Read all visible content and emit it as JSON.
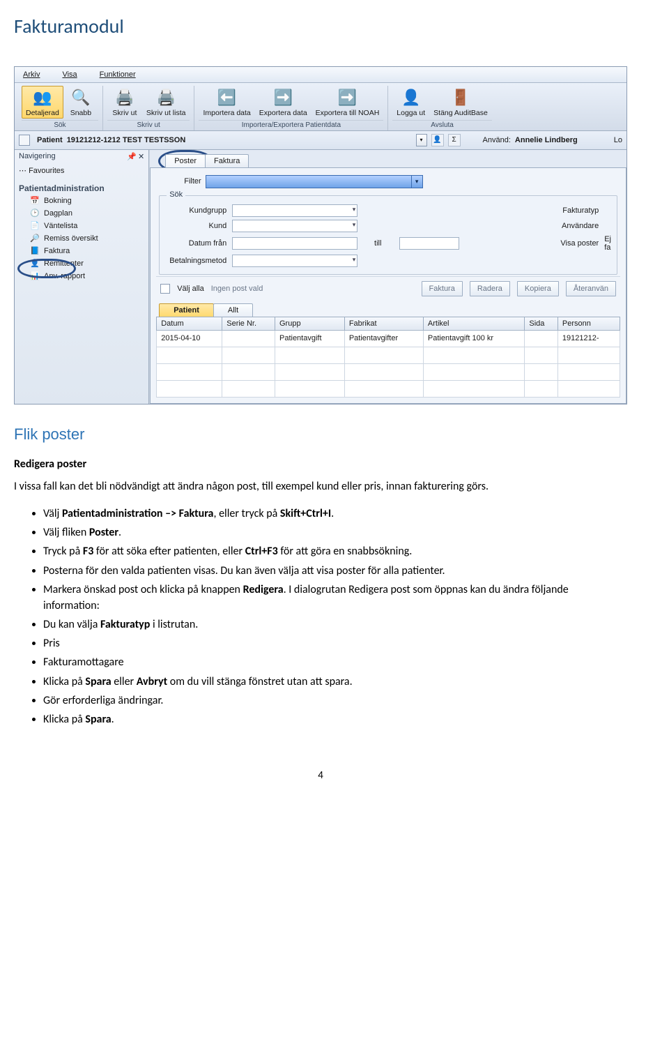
{
  "doc": {
    "page_title": "Fakturamodul",
    "section_title": "Flik poster",
    "sub_heading": "Redigera poster",
    "intro": "I vissa fall kan det bli nödvändigt att ändra någon post, till exempel kund eller pris, innan fakturering görs.",
    "bullets": {
      "b1a": "Välj ",
      "b1b": "Patientadministration –> Faktura",
      "b1c": ", eller tryck på ",
      "b1d": "Skift+Ctrl+I",
      "b1e": ".",
      "b2a": "Välj fliken ",
      "b2b": "Poster",
      "b2c": ".",
      "b3a": "Tryck på ",
      "b3b": "F3",
      "b3c": " för att söka efter patienten, eller ",
      "b3d": "Ctrl+F3",
      "b3e": " för att göra en snabbsökning.",
      "b4": "Posterna för den valda patienten visas. Du kan även välja att visa poster för alla patienter.",
      "b5a": "Markera önskad post och klicka på knappen ",
      "b5b": "Redigera",
      "b5c": ". I dialogrutan Redigera post som öppnas kan du ändra följande information:",
      "b6a": "Du kan välja ",
      "b6b": "Fakturatyp",
      "b6c": " i listrutan.",
      "b7": "Pris",
      "b8": "Fakturamottagare",
      "b9a": "Klicka på ",
      "b9b": "Spara",
      "b9c": " eller ",
      "b9d": "Avbryt",
      "b9e": " om du vill stänga fönstret utan att spara.",
      "b10": "Gör erforderliga ändringar.",
      "b11a": "Klicka på ",
      "b11b": "Spara",
      "b11c": "."
    },
    "page_number": "4"
  },
  "app": {
    "menu": {
      "arkiv": "Arkiv",
      "visa": "Visa",
      "funktioner": "Funktioner"
    },
    "ribbon": {
      "detaljerad": "Detaljerad",
      "snabb": "Snabb",
      "skrivut": "Skriv ut",
      "skrivutlista": "Skriv ut lista",
      "importera": "Importera data",
      "exportera": "Exportera data",
      "noah": "Exportera till NOAH",
      "loggaut": "Logga ut",
      "stang": "Stäng AuditBase",
      "grp_sok": "Sök",
      "grp_skriv": "Skriv ut",
      "grp_imp": "Importera/Exportera Patientdata",
      "grp_avs": "Avsluta"
    },
    "patientbar": {
      "label": "Patient",
      "value": "19121212-1212 TEST TESTSSON",
      "user_lbl": "Använd:",
      "user_val": "Annelie Lindberg",
      "lo": "Lo"
    },
    "nav": {
      "title": "Navigering",
      "favourites": "Favourites",
      "group": "Patientadministration",
      "items": [
        {
          "icon": "📅",
          "label": "Bokning"
        },
        {
          "icon": "🕑",
          "label": "Dagplan"
        },
        {
          "icon": "📄",
          "label": "Väntelista"
        },
        {
          "icon": "🔎",
          "label": "Remiss översikt"
        },
        {
          "icon": "📘",
          "label": "Faktura"
        },
        {
          "icon": "👤",
          "label": "Remittenter"
        },
        {
          "icon": "📊",
          "label": "Anv. rapport"
        }
      ]
    },
    "tabs": {
      "poster": "Poster",
      "faktura": "Faktura"
    },
    "filter_label": "Filter",
    "sok": {
      "legend": "Sök",
      "kundgrupp": "Kundgrupp",
      "kund": "Kund",
      "datumfran": "Datum från",
      "till": "till",
      "betalning": "Betalningsmetod",
      "fakturatyp": "Fakturatyp",
      "anvandare": "Användare",
      "visaposter": "Visa poster",
      "visaposter_val": "Ej fa"
    },
    "btnbar": {
      "valj_alla": "Välj alla",
      "ingen": "Ingen post vald",
      "faktura": "Faktura",
      "radera": "Radera",
      "kopiera": "Kopiera",
      "ateranvan": "Återanvän"
    },
    "subtabs": {
      "patient": "Patient",
      "allt": "Allt"
    },
    "grid": {
      "cols": [
        "Datum",
        "Serie Nr.",
        "Grupp",
        "Fabrikat",
        "Artikel",
        "Sida",
        "Personn"
      ],
      "row1": {
        "datum": "2015-04-10",
        "serie": "",
        "grupp": "Patientavgift",
        "fabrikat": "Patientavgifter",
        "artikel": "Patientavgift 100 kr",
        "sida": "",
        "personn": "19121212-"
      }
    }
  }
}
